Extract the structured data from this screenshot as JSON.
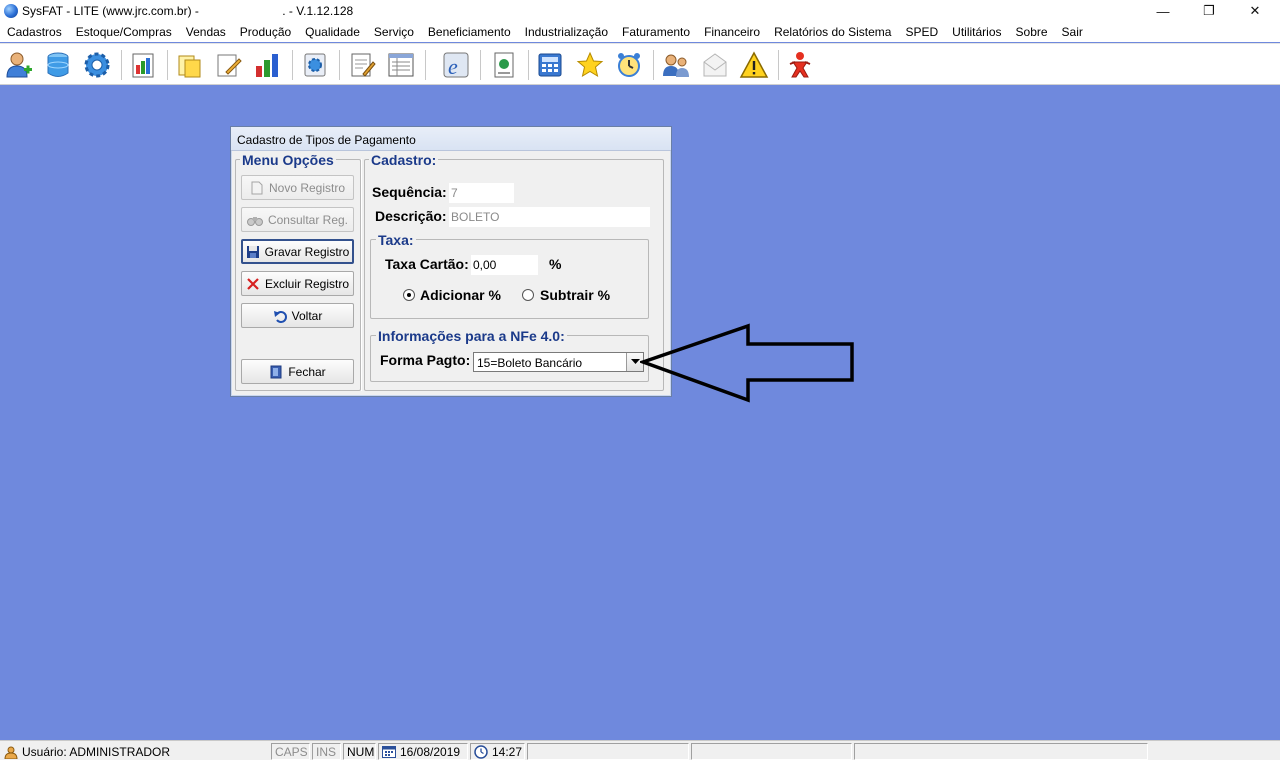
{
  "window": {
    "title": "SysFAT - LITE (www.jrc.com.br) -                         . - V.1.12.128",
    "minimize_glyph": "—",
    "restore_glyph": "❐",
    "close_glyph": "✕"
  },
  "menu": [
    "Cadastros",
    "Estoque/Compras",
    "Vendas",
    "Produção",
    "Qualidade",
    "Serviço",
    "Beneficiamento",
    "Industrialização",
    "Faturamento",
    "Financeiro",
    "Relatórios do Sistema",
    "SPED",
    "Utilitários",
    "Sobre",
    "Sair"
  ],
  "toolbar_icons": [
    "user-add-icon",
    "database-icon",
    "gear-icon",
    "report-chart-icon",
    "folder-icon",
    "edit-document-icon",
    "bar-chart-icon",
    "settings-document-icon",
    "notepad-icon",
    "list-form-icon",
    "nfe-icon",
    "certificate-icon",
    "calculator-icon",
    "star-icon",
    "alarm-clock-icon",
    "users-chat-icon",
    "mail-icon",
    "warning-icon",
    "logout-icon"
  ],
  "dialog": {
    "title": "Cadastro de Tipos de Pagamento",
    "menu_group": "Menu Opções",
    "buttons": {
      "novo": "Novo Registro",
      "consultar": "Consultar Reg.",
      "gravar": "Gravar Registro",
      "excluir": "Excluir Registro",
      "voltar": "Voltar",
      "fechar": "Fechar"
    },
    "cadastro_group": "Cadastro:",
    "sequencia_label": "Sequência:",
    "sequencia_value": "7",
    "descricao_label": "Descrição:",
    "descricao_value": "BOLETO",
    "taxa_group": "Taxa:",
    "taxa_label": "Taxa Cartão:",
    "taxa_value": "0,00",
    "taxa_unit": "%",
    "radio_adicionar": "Adicionar %",
    "radio_subtrair": "Subtrair %",
    "selected_radio": "adicionar",
    "nfe_group": "Informações para a NFe 4.0:",
    "forma_label": "Forma Pagto:",
    "forma_value": "15=Boleto Bancário"
  },
  "status": {
    "user": "Usuário: ADMINISTRADOR",
    "caps": "CAPS",
    "ins": "INS",
    "num": "NUM",
    "date": "16/08/2019",
    "time": "14:27"
  }
}
